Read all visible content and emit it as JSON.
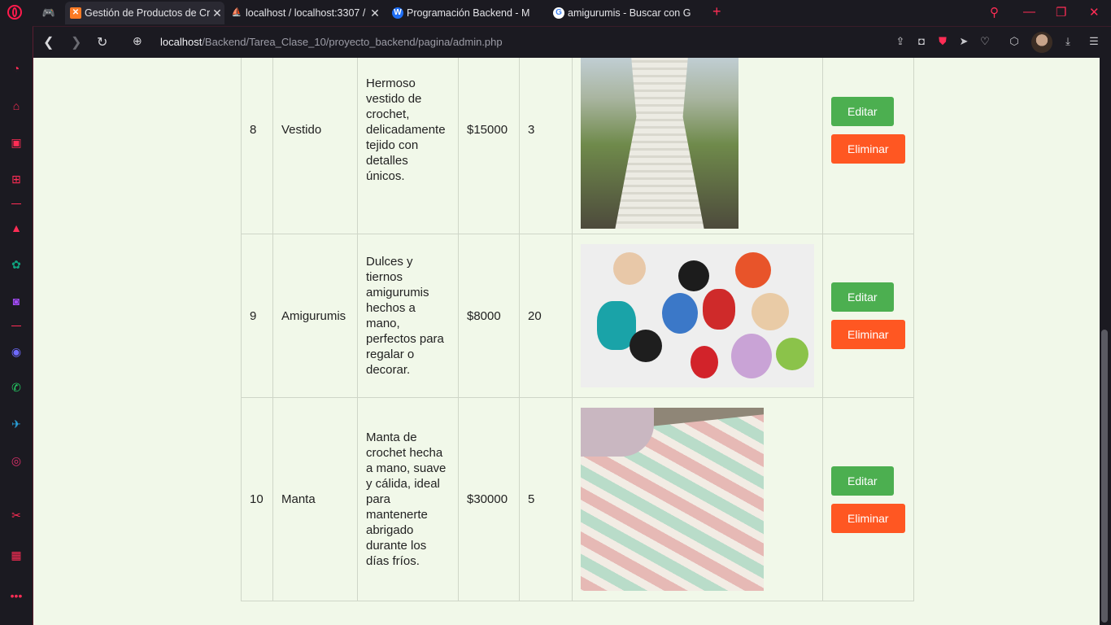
{
  "browser": {
    "tabs": [
      {
        "label": "Gestión de Productos de Cr",
        "active": true,
        "favicon": "xampp-icon"
      },
      {
        "label": "localhost / localhost:3307 /",
        "active": false,
        "favicon": "phpmyadmin-icon"
      },
      {
        "label": "Programación Backend - M",
        "active": false,
        "favicon": "webex-icon"
      },
      {
        "label": "amigurumis - Buscar con G",
        "active": false,
        "favicon": "google-icon"
      }
    ],
    "url_host": "localhost",
    "url_path": "/Backend/Tarea_Clase_10/proyecto_backend/pagina/admin.php"
  },
  "sidebar_icons": [
    "speed-dial-icon",
    "shopping-bag-icon",
    "twitch-icon",
    "ai-chip-icon",
    "aria-icon",
    "chatgpt-icon",
    "chatsonic-icon",
    "messenger-icon",
    "whatsapp-icon",
    "telegram-icon",
    "instagram-icon",
    "crypto-wallet-icon",
    "image-gallery-icon",
    "more-icon"
  ],
  "products": [
    {
      "id": "8",
      "name": "Vestido",
      "description": "Hermoso vestido de crochet, delicadamente tejido con detalles únicos.",
      "price": "$15000",
      "stock": "3",
      "image": "crocheted-white-dress-photo",
      "edit_label": "Editar",
      "delete_label": "Eliminar"
    },
    {
      "id": "9",
      "name": "Amigurumis",
      "description": "Dulces y tiernos amigurumis hechos a mano, perfectos para regalar o decorar.",
      "price": "$8000",
      "stock": "20",
      "image": "amigurumi-dolls-photo",
      "edit_label": "Editar",
      "delete_label": "Eliminar"
    },
    {
      "id": "10",
      "name": "Manta",
      "description": "Manta de crochet hecha a mano, suave y cálida, ideal para mantenerte abrigado durante los días fríos.",
      "price": "$30000",
      "stock": "5",
      "image": "crocheted-blanket-photo",
      "edit_label": "Editar",
      "delete_label": "Eliminar"
    }
  ],
  "colors": {
    "page_bg": "#f1f8e9",
    "edit_button": "#4caf50",
    "delete_button": "#ff5722",
    "browser_accent": "#ff2d55"
  }
}
